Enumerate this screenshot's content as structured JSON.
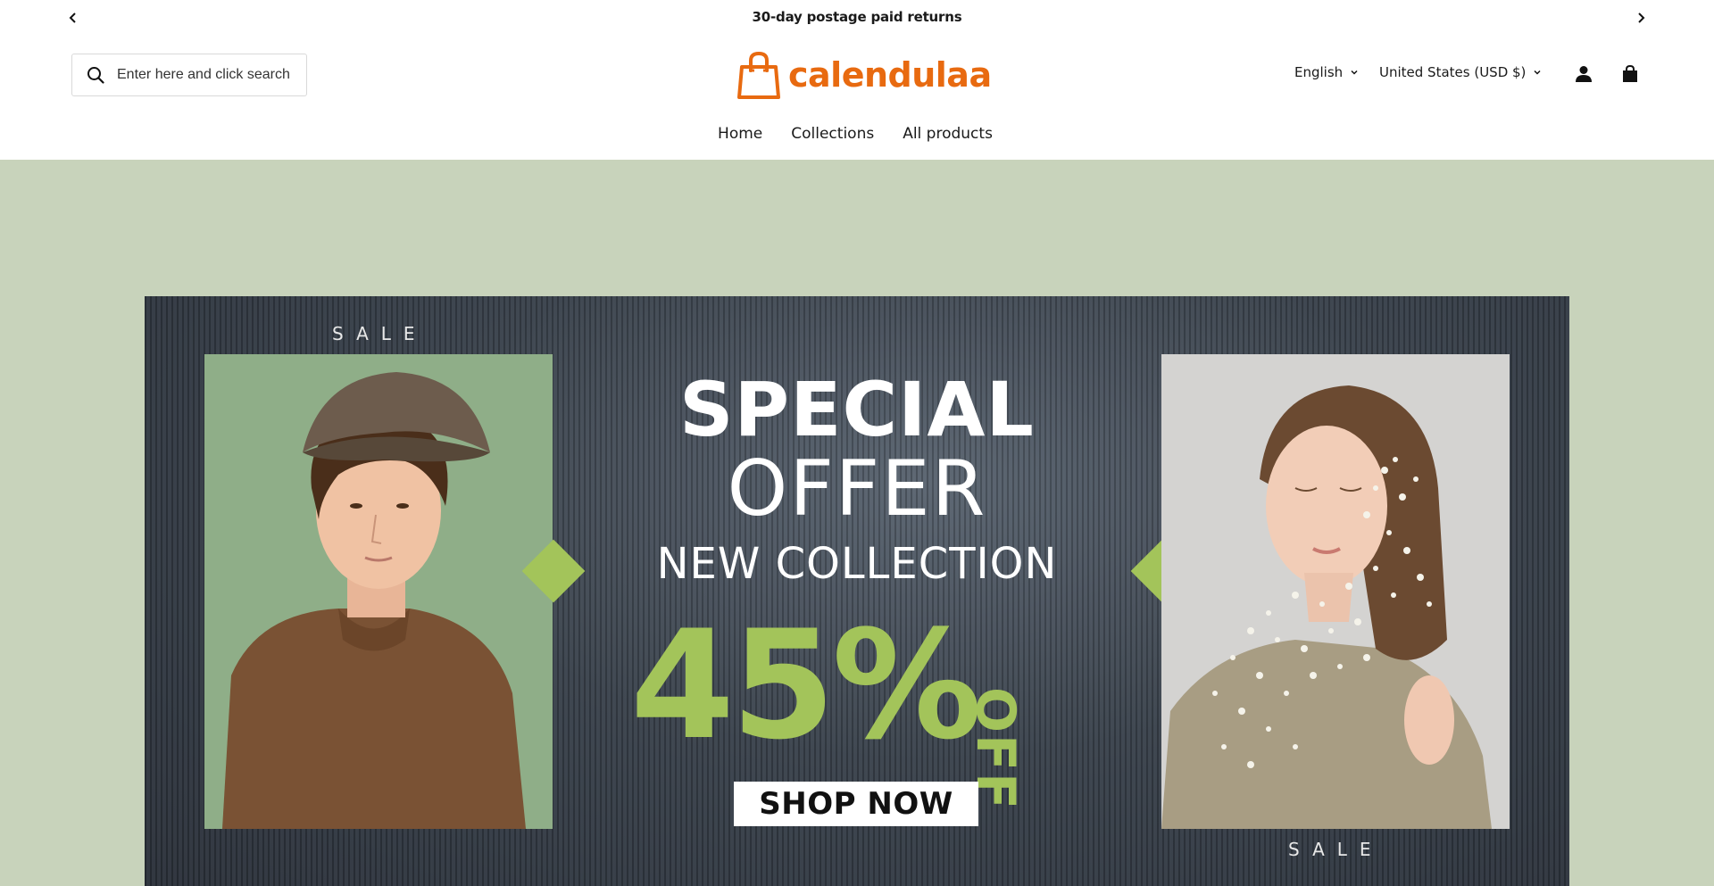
{
  "announcement": {
    "message": "30-day postage paid returns",
    "prev_icon": "chevron-left-icon",
    "next_icon": "chevron-right-icon"
  },
  "header": {
    "search": {
      "placeholder": "Enter here and click search",
      "icon": "search-icon"
    },
    "logo": {
      "text": "calendulaa",
      "icon": "shopping-bag-icon",
      "color": "#e86a10"
    },
    "language": {
      "selected": "English"
    },
    "currency": {
      "selected": "United States (USD $)"
    },
    "account_icon": "user-icon",
    "cart_icon": "cart-icon"
  },
  "nav": {
    "items": [
      {
        "label": "Home"
      },
      {
        "label": "Collections"
      },
      {
        "label": "All products"
      }
    ]
  },
  "hero": {
    "background": "#c8d3bb",
    "accent": "#a3c45a",
    "sale_top": "SALE",
    "sale_bottom": "SALE",
    "line1": "SPECIAL",
    "line2": "OFFER",
    "line3": "NEW COLLECTION",
    "discount": "45%",
    "off": "OFF",
    "cta": "SHOP NOW"
  }
}
